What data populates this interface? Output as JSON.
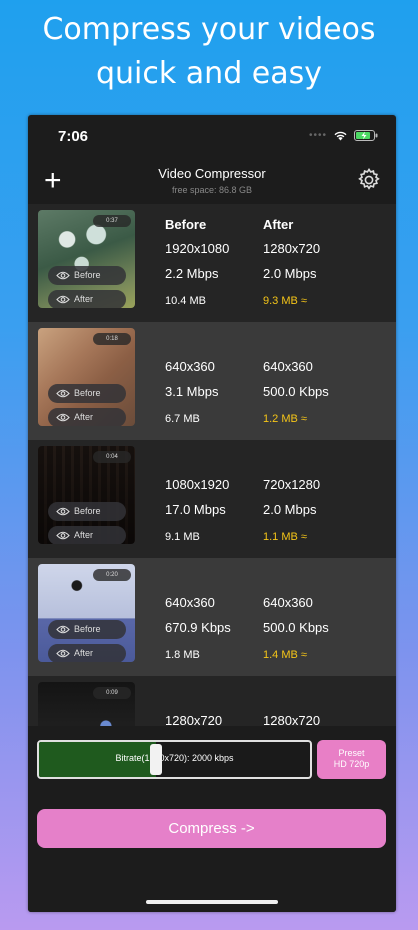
{
  "headline": {
    "line1": "Compress your videos",
    "line2": "quick and easy"
  },
  "status": {
    "time": "7:06"
  },
  "nav": {
    "title": "Video Compressor",
    "subtitle": "free space: 86.8 GB"
  },
  "columns": {
    "before": "Before",
    "after": "After"
  },
  "thumb_buttons": {
    "before": "Before",
    "after": "After"
  },
  "videos": [
    {
      "duration": "0:37",
      "before_res": "1920x1080",
      "after_res": "1280x720",
      "before_rate": "2.2 Mbps",
      "after_rate": "2.0 Mbps",
      "before_size": "10.4 MB",
      "after_size": "9.3 MB ≈",
      "show_headers": true
    },
    {
      "duration": "0:18",
      "before_res": "640x360",
      "after_res": "640x360",
      "before_rate": "3.1 Mbps",
      "after_rate": "500.0 Kbps",
      "before_size": "6.7 MB",
      "after_size": "1.2 MB ≈",
      "show_headers": false
    },
    {
      "duration": "0:04",
      "before_res": "1080x1920",
      "after_res": "720x1280",
      "before_rate": "17.0 Mbps",
      "after_rate": "2.0 Mbps",
      "before_size": "9.1 MB",
      "after_size": "1.1 MB ≈",
      "show_headers": false
    },
    {
      "duration": "0:20",
      "before_res": "640x360",
      "after_res": "640x360",
      "before_rate": "670.9 Kbps",
      "after_rate": "500.0 Kbps",
      "before_size": "1.8 MB",
      "after_size": "1.4 MB ≈",
      "show_headers": false
    },
    {
      "duration": "0:09",
      "before_res": "1280x720",
      "after_res": "1280x720",
      "before_rate": "",
      "after_rate": "",
      "before_size": "",
      "after_size": "",
      "show_headers": false
    }
  ],
  "slider": {
    "label": "Bitrate(1280x720): 2000 kbps",
    "level": 0.43
  },
  "preset": {
    "line1": "Preset",
    "line2": "HD 720p"
  },
  "compress_button": "Compress ->",
  "colors": {
    "accent_pink": "#e580c9",
    "slider_fill": "#1f5a1e",
    "after_size": "#f5c518"
  }
}
